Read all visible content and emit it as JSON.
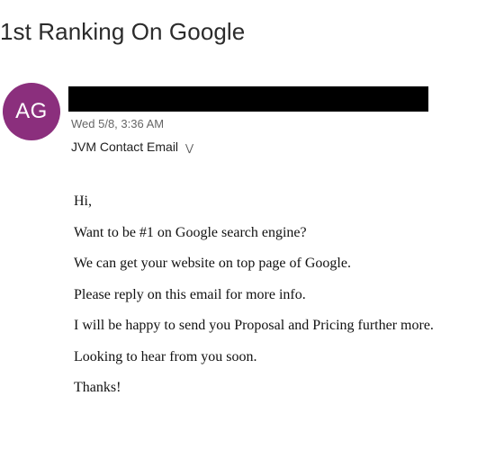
{
  "email": {
    "subject": "1st Ranking On Google",
    "avatar_initials": "AG",
    "avatar_color": "#8b2f7d",
    "date": "Wed 5/8, 3:36 AM",
    "recipient": "JVM Contact Email",
    "recipient_icon": "chevron-double-down-icon",
    "body_lines": [
      "Hi,",
      "Want to be #1 on Google search engine?",
      "We can get your website on top page of Google.",
      "Please reply on this email for more info.",
      "I will be happy to send you Proposal and Pricing further more.",
      "Looking to hear from you soon.",
      "Thanks!"
    ]
  }
}
